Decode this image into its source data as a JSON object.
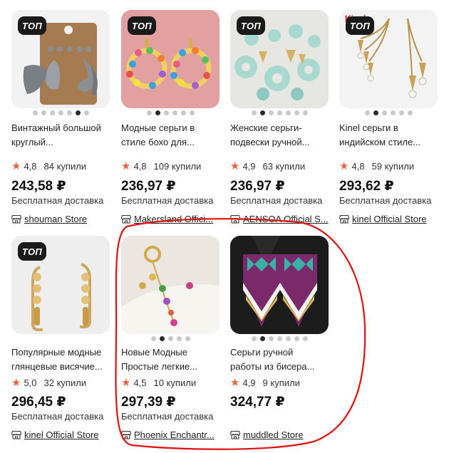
{
  "products": [
    {
      "badge": "ТОП",
      "title_line1": "Винтажный большой",
      "title_line2": "круглый...",
      "rating": "4,8",
      "sold": "84 купили",
      "price": "243,58 ₽",
      "delivery": "Бесплатная доставка",
      "store": "shouman Store",
      "dots_total": 7,
      "dot_active": 5,
      "thumb_logo": ""
    },
    {
      "badge": "ТОП",
      "title_line1": "Модные серьги в",
      "title_line2": "стиле бохо для...",
      "rating": "4,8",
      "sold": "109 купили",
      "price": "236,97 ₽",
      "delivery": "Бесплатная доставка",
      "store": "Makersland Offici...",
      "dots_total": 6,
      "dot_active": 1,
      "thumb_logo": ""
    },
    {
      "badge": "ТОП",
      "title_line1": "Женские серьги-",
      "title_line2": "подвески ручной...",
      "rating": "4,9",
      "sold": "63 купили",
      "price": "236,97 ₽",
      "delivery": "Бесплатная доставка",
      "store": "AENSOA Official S...",
      "dots_total": 7,
      "dot_active": 1,
      "thumb_logo": ""
    },
    {
      "badge": "ТОП",
      "title_line1": "Kinel серьги в",
      "title_line2": "индийском стиле...",
      "rating": "4,8",
      "sold": "59 купили",
      "price": "293,62 ₽",
      "delivery": "Бесплатная доставка",
      "store": "kinel Official Store",
      "dots_total": 6,
      "dot_active": 1,
      "thumb_logo": "Kinel"
    },
    {
      "badge": "ТОП",
      "title_line1": "Популярные модные",
      "title_line2": "глянцевые висячие...",
      "rating": "5,0",
      "sold": "32 купили",
      "price": "296,45 ₽",
      "delivery": "Бесплатная доставка",
      "store": "kinel Official Store",
      "dots_total": 0,
      "dot_active": 0,
      "thumb_logo": ""
    },
    {
      "badge": "",
      "title_line1": "Новые Модные",
      "title_line2": "Простые легкие...",
      "rating": "4,5",
      "sold": "10 купили",
      "price": "297,39 ₽",
      "delivery": "Бесплатная доставка",
      "store": "Phoenix Enchantr...",
      "dots_total": 5,
      "dot_active": 1,
      "thumb_logo": ""
    },
    {
      "badge": "",
      "title_line1": "Серьги ручной",
      "title_line2": "работы из бисера...",
      "rating": "4,9",
      "sold": "9 купили",
      "price": "324,77 ₽",
      "delivery": "",
      "store": "muddled Store",
      "dots_total": 7,
      "dot_active": 1,
      "thumb_logo": ""
    }
  ],
  "icons": {
    "rating": "star-icon",
    "store": "storefront-icon"
  },
  "colors": {
    "star": "#e8643d",
    "annotation": "#e01010",
    "badge_bg": "#1a1a1a"
  }
}
